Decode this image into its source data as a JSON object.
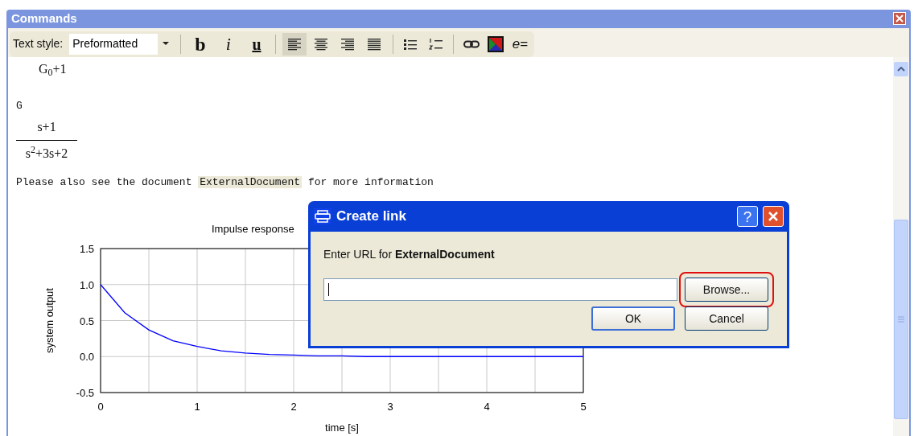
{
  "window": {
    "title": "Commands"
  },
  "toolbar": {
    "text_style_label": "Text style:",
    "text_style_value": "Preformatted",
    "format_buttons": [
      {
        "kind": "bold",
        "label": "b"
      },
      {
        "kind": "italic",
        "label": "i"
      },
      {
        "kind": "underline",
        "label": "u"
      }
    ],
    "alignment_buttons": [
      {
        "kind": "left",
        "selected": true
      },
      {
        "kind": "center",
        "selected": false
      },
      {
        "kind": "right",
        "selected": false
      },
      {
        "kind": "justify",
        "selected": false
      }
    ],
    "equation_button": "e="
  },
  "document": {
    "blocks": [
      {
        "kind": "math",
        "text": "G$_{0}$+1"
      },
      {
        "kind": "code",
        "text": "G"
      },
      {
        "kind": "fraction",
        "numerator": "s+1",
        "denominator": "s$^{2}$+3s+2"
      },
      {
        "kind": "paragraph",
        "before": "Please also see the document",
        "highlight": "ExternalDocument",
        "after": "for more information"
      }
    ],
    "chart_data": {
      "type": "line",
      "title": "Impulse response",
      "xlabel": "time [s]",
      "ylabel": "system output",
      "x": [
        0,
        0.25,
        0.5,
        0.75,
        1,
        1.25,
        1.5,
        1.75,
        2,
        2.25,
        2.5,
        2.75,
        3,
        3.25,
        3.5,
        3.75,
        4,
        4.25,
        4.5,
        4.75,
        5
      ],
      "series": [
        {
          "color": "#0000ff",
          "values": [
            1,
            0.61,
            0.37,
            0.22,
            0.14,
            0.08,
            0.05,
            0.03,
            0.02,
            0.01,
            0.01,
            0,
            0,
            0,
            0,
            0,
            0,
            0,
            0,
            0,
            0
          ]
        }
      ],
      "grid": true,
      "xlim": [
        0,
        5
      ],
      "ylim": [
        -0.5,
        1.5
      ],
      "xticks": [
        0,
        1,
        2,
        3,
        4,
        5
      ],
      "yticks": [
        {
          "value": -0.5,
          "label": "-0.5"
        },
        {
          "value": 0,
          "label": "0.0"
        },
        {
          "value": 0.5,
          "label": "0.5"
        },
        {
          "value": 1,
          "label": "1.0"
        },
        {
          "value": 1.5,
          "label": "1.5"
        }
      ]
    }
  },
  "dialog": {
    "title": "Create link",
    "help": "?",
    "prompt": "Enter URL for **ExternalDocument**",
    "browse_button": {
      "label": "Browse...",
      "highlighted": true
    },
    "buttons": [
      {
        "label": "OK",
        "default": true
      },
      {
        "label": "Cancel",
        "default": false
      }
    ]
  }
}
